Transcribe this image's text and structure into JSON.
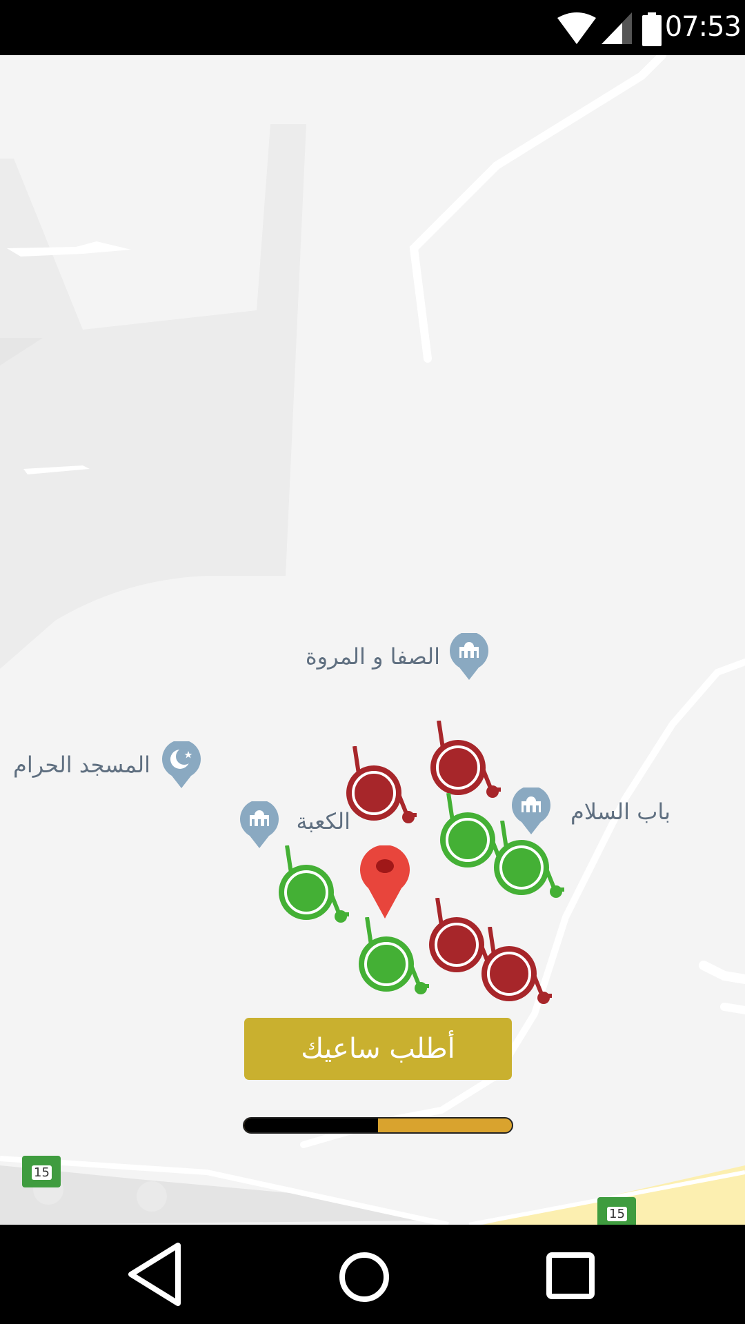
{
  "status_bar": {
    "time": "07:53",
    "icons": [
      "wifi-icon",
      "cellular-signal-icon",
      "battery-icon"
    ]
  },
  "map": {
    "labels": {
      "safa_marwa": "الصفا و المروة",
      "masjid_haram": "المسجد الحرام",
      "kaaba": "الكعبة",
      "bab_salam": "باب السلام"
    },
    "route_shields": [
      "15",
      "15"
    ],
    "pin_color": "#e8453c",
    "available_color": "#44b035",
    "busy_color": "#a7262a"
  },
  "request_button": {
    "label": "أطلب ساعيك",
    "color": "#c9b02f"
  },
  "progress": {
    "value": 0.5
  },
  "nav": {
    "icons": [
      "back-icon",
      "home-icon",
      "recents-icon"
    ]
  }
}
